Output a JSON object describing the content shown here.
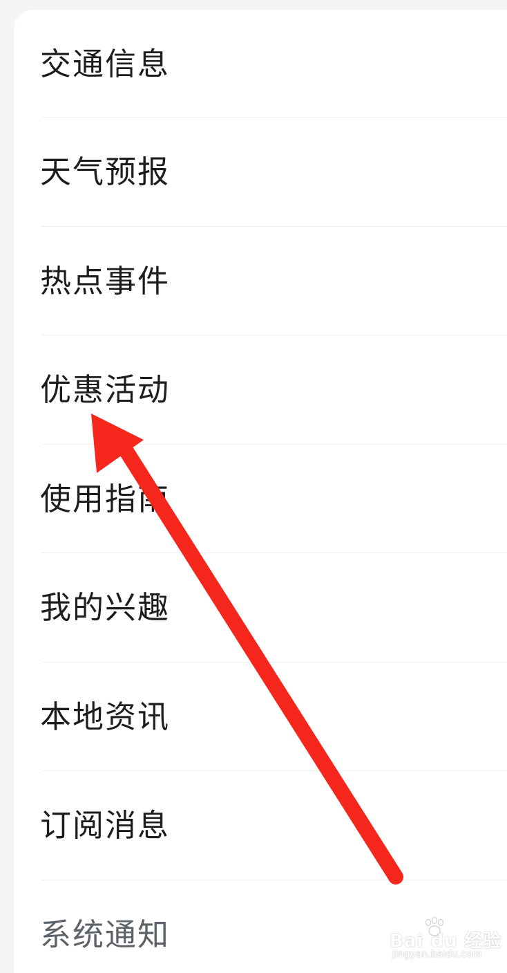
{
  "menu": {
    "items": [
      {
        "label": "交通信息"
      },
      {
        "label": "天气预报"
      },
      {
        "label": "热点事件"
      },
      {
        "label": "优惠活动"
      },
      {
        "label": "使用指南"
      },
      {
        "label": "我的兴趣"
      },
      {
        "label": "本地资讯"
      },
      {
        "label": "订阅消息"
      },
      {
        "label": "系统通知"
      }
    ]
  },
  "annotation": {
    "arrow_color": "#f5261b",
    "points_to": "优惠活动"
  },
  "watermark": {
    "brand": "Bai du 经验",
    "url": "jingyan.baidu.com"
  },
  "colors": {
    "background": "#f4f5f7",
    "card": "#ffffff",
    "text": "#1d1d1f",
    "muted_text": "#5d6168",
    "divider": "#eeeff1"
  }
}
